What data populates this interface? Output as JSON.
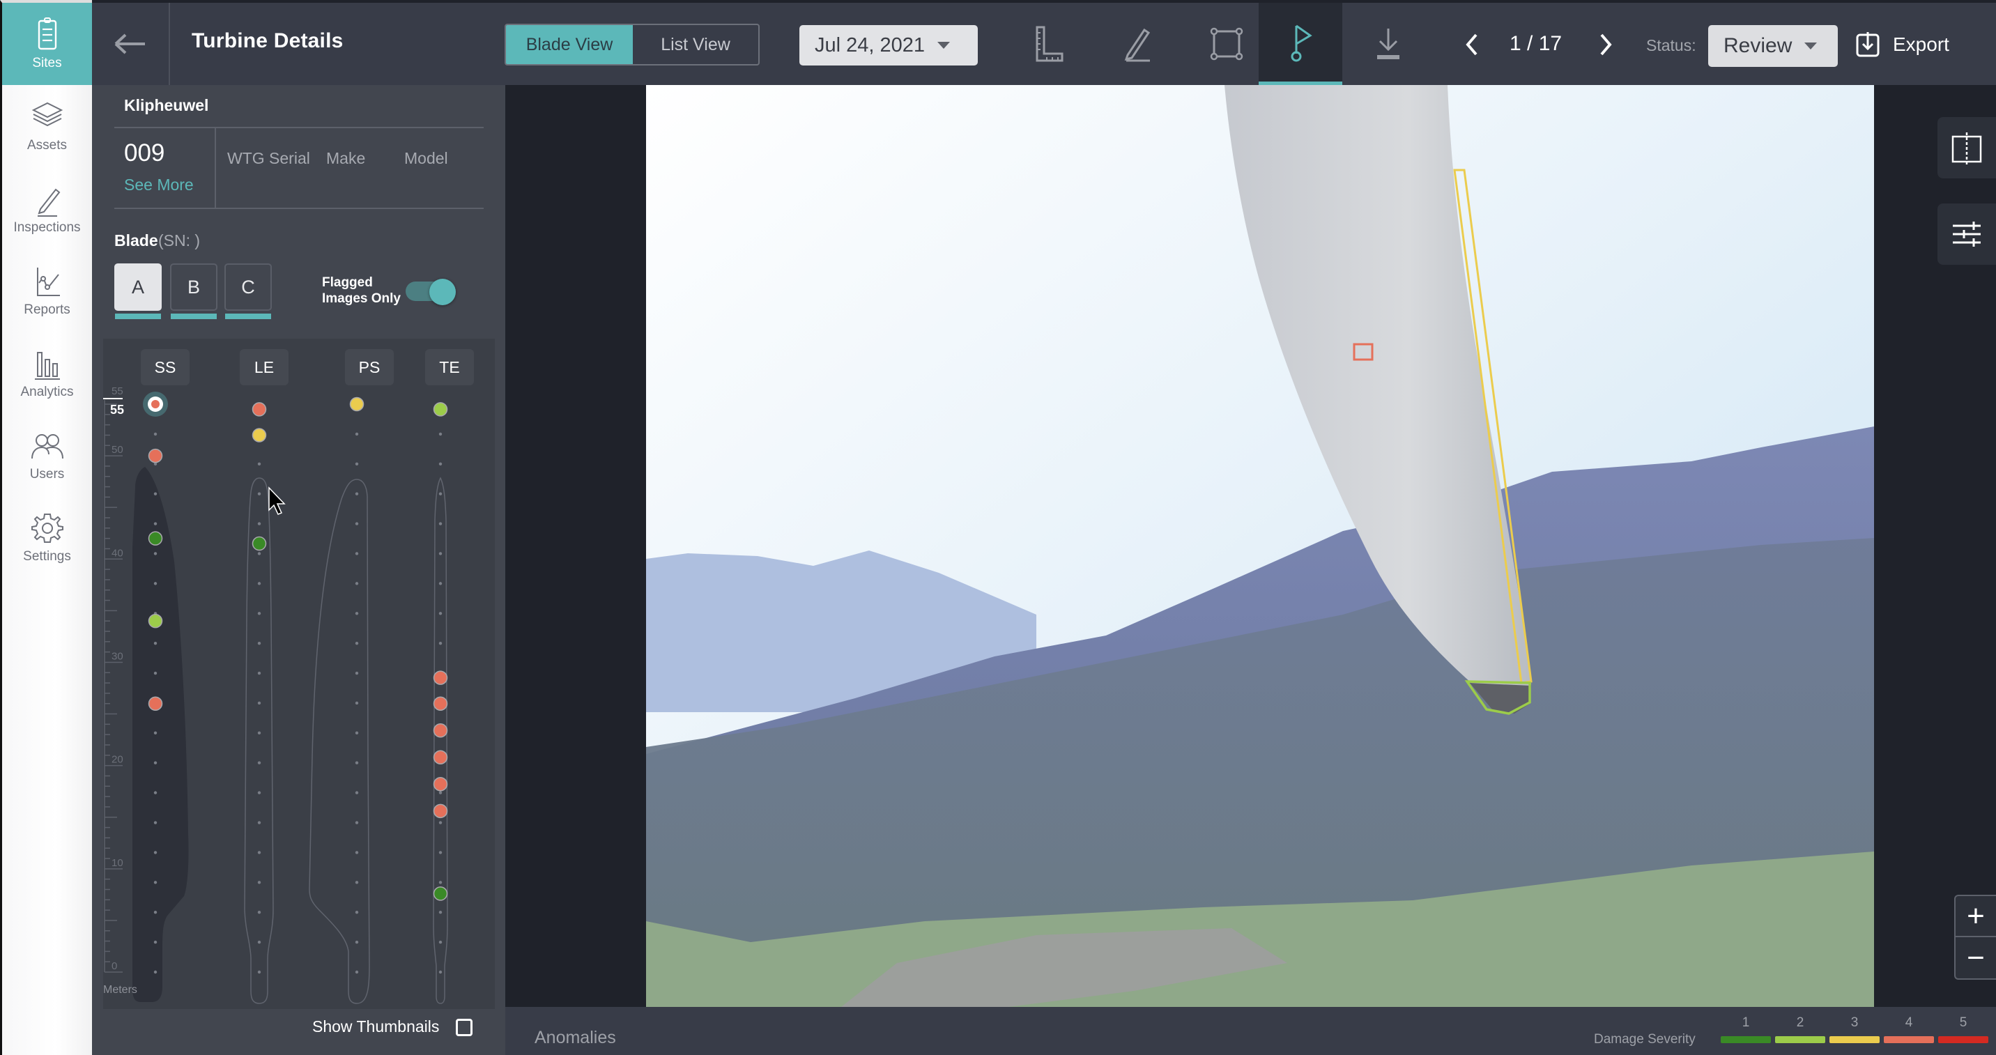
{
  "nav": {
    "items": [
      {
        "label": "Sites",
        "icon": "clipboard-icon",
        "active": true
      },
      {
        "label": "Assets",
        "icon": "layers-icon",
        "active": false
      },
      {
        "label": "Inspections",
        "icon": "pencil-icon",
        "active": false
      },
      {
        "label": "Reports",
        "icon": "line-chart-icon",
        "active": false
      },
      {
        "label": "Analytics",
        "icon": "bar-chart-icon",
        "active": false
      },
      {
        "label": "Users",
        "icon": "users-icon",
        "active": false
      },
      {
        "label": "Settings",
        "icon": "gear-icon",
        "active": false
      }
    ]
  },
  "topbar": {
    "title": "Turbine Details",
    "view_toggle": {
      "active": "Blade View",
      "inactive": "List View"
    },
    "date": "Jul 24, 2021",
    "tools": [
      "ruler-icon",
      "pencil-icon",
      "bounding-box-icon",
      "flag-icon",
      "download-icon"
    ],
    "active_tool": "flag-icon",
    "pager": {
      "current": 1,
      "total": 17,
      "text": "1 / 17"
    },
    "status_label": "Status:",
    "status_value": "Review",
    "export_label": "Export"
  },
  "panel": {
    "site_name": "Klipheuwel",
    "turbine_id": "009",
    "see_more": "See More",
    "meta_columns": [
      "WTG Serial",
      "Make",
      "Model"
    ],
    "blade_label": "Blade",
    "blade_sn": "(SN: )",
    "blades": [
      {
        "label": "A",
        "active": true
      },
      {
        "label": "B",
        "active": false
      },
      {
        "label": "C",
        "active": false
      }
    ],
    "flagged_label_line1": "Flagged",
    "flagged_label_line2": "Images Only",
    "flagged_only": true,
    "sides": [
      "SS",
      "LE",
      "PS",
      "TE"
    ],
    "ruler": {
      "unit_label": "Meters",
      "max_label": "55",
      "current_position_label": "55",
      "tick_labels": [
        "55",
        "50",
        "40",
        "30",
        "20",
        "10",
        "0"
      ],
      "max_m": 55
    },
    "show_thumbnails_label": "Show Thumbnails",
    "show_thumbnails": false
  },
  "blade_findings": {
    "SS": [
      {
        "m": 55,
        "severity": 4,
        "selected": true
      },
      {
        "m": 50,
        "severity": 4
      },
      {
        "m": 42,
        "severity": 1
      },
      {
        "m": 34,
        "severity": 2
      },
      {
        "m": 26,
        "severity": 4
      }
    ],
    "LE": [
      {
        "m": 54.5,
        "severity": 4
      },
      {
        "m": 52,
        "severity": 3
      },
      {
        "m": 41.5,
        "severity": 1
      }
    ],
    "PS": [
      {
        "m": 55,
        "severity": 3
      }
    ],
    "TE": [
      {
        "m": 54.5,
        "severity": 2
      },
      {
        "m": 28.5,
        "severity": 4
      },
      {
        "m": 26,
        "severity": 4
      },
      {
        "m": 23.4,
        "severity": 4
      },
      {
        "m": 20.8,
        "severity": 4
      },
      {
        "m": 18.2,
        "severity": 4
      },
      {
        "m": 15.6,
        "severity": 4
      },
      {
        "m": 7.6,
        "severity": 1
      }
    ]
  },
  "image_annotations": [
    {
      "type": "rect",
      "severity": 4,
      "label": "small-defect"
    },
    {
      "type": "polygon",
      "severity": 3,
      "label": "trailing-edge"
    },
    {
      "type": "polygon",
      "severity": 2,
      "label": "blade-tip"
    }
  ],
  "viewer": {
    "side_controls": [
      "split-view-icon",
      "adjustments-icon"
    ],
    "zoom_in": "+",
    "zoom_out": "−"
  },
  "bottombar": {
    "anomalies_label": "Anomalies",
    "severity_label": "Damage Severity",
    "severity_levels": [
      {
        "level": "1",
        "color": "#3a8a26"
      },
      {
        "level": "2",
        "color": "#9ccc4a"
      },
      {
        "level": "3",
        "color": "#ebcc4e"
      },
      {
        "level": "4",
        "color": "#e5705a"
      },
      {
        "level": "5",
        "color": "#d42a22"
      }
    ]
  },
  "colors": {
    "accent": "#5cb8b9",
    "severity": {
      "1": "#3a8a26",
      "2": "#9ccc4a",
      "3": "#ebcc4e",
      "4": "#e5705a",
      "5": "#d42a22"
    }
  }
}
